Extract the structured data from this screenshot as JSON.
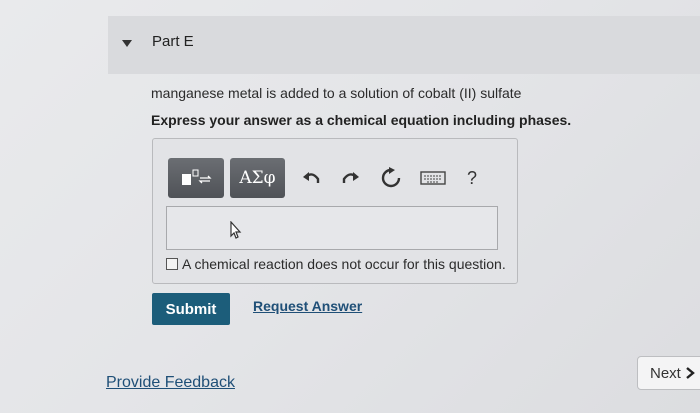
{
  "part": {
    "title": "Part E"
  },
  "question": {
    "prompt": "manganese metal is added to a solution of cobalt (II) sulfate",
    "instruction": "Express your answer as a chemical equation including phases."
  },
  "toolbar": {
    "symbols_label": "ΑΣφ",
    "help_label": "?",
    "icons": [
      "templates-icon",
      "undo-icon",
      "redo-icon",
      "reset-icon",
      "keyboard-icon",
      "help-icon"
    ]
  },
  "answer": {
    "value": ""
  },
  "no_reaction": {
    "label": "A chemical reaction does not occur for this question.",
    "checked": false
  },
  "actions": {
    "submit_label": "Submit",
    "request_answer_label": "Request Answer"
  },
  "footer": {
    "feedback_label": "Provide Feedback",
    "next_label": "Next"
  },
  "colors": {
    "submit_bg": "#1c5d7a",
    "link": "#1f4f77",
    "toolbar_btn": "#5a5d62"
  }
}
